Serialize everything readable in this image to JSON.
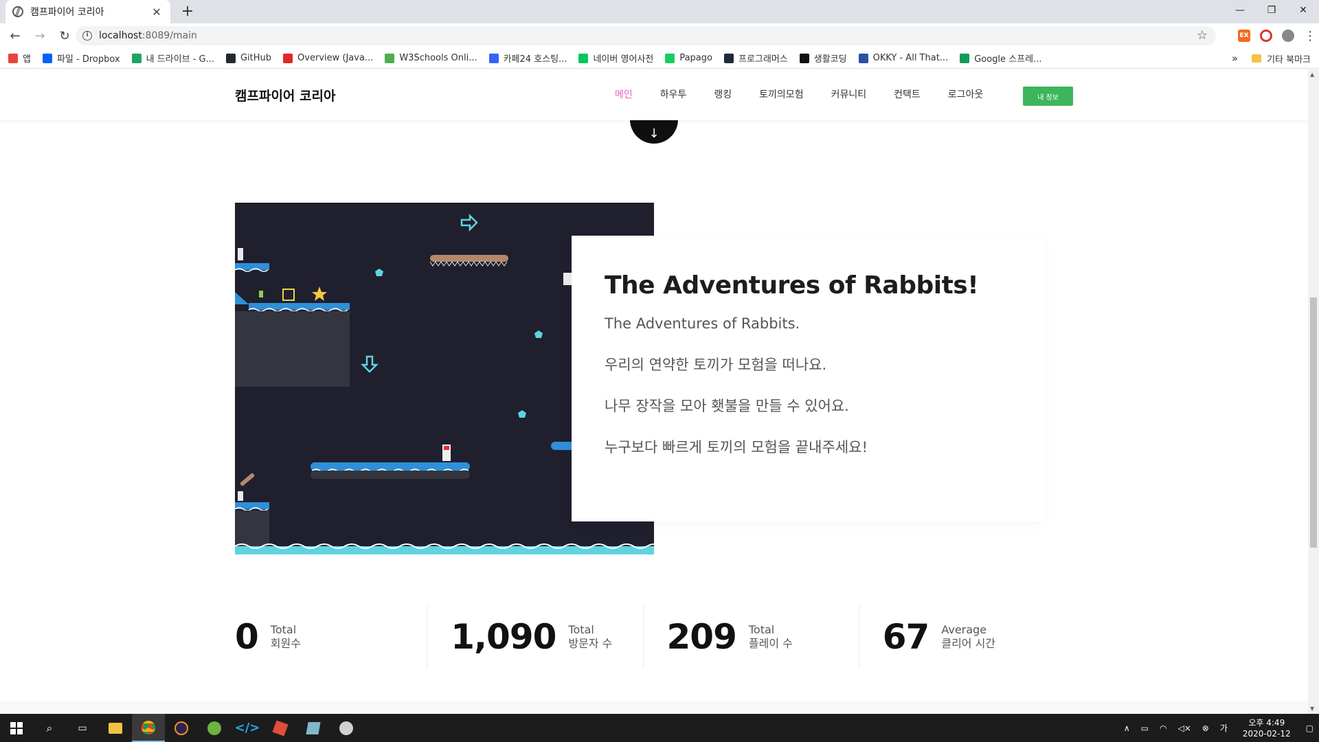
{
  "browser": {
    "tab_title": "캠프파이어 코리아",
    "url_host": "localhost",
    "url_rest": ":8089/main",
    "bookmarks": [
      {
        "label": "앱",
        "color": "#e8453c"
      },
      {
        "label": "파일 - Dropbox",
        "color": "#0061fe"
      },
      {
        "label": "내 드라이브 - G...",
        "color": "#1fa463"
      },
      {
        "label": "GitHub",
        "color": "#24292e"
      },
      {
        "label": "Overview (Java...",
        "color": "#e02828"
      },
      {
        "label": "W3Schools Onli...",
        "color": "#4caf50"
      },
      {
        "label": "카페24 호스팅...",
        "color": "#3463f6"
      },
      {
        "label": "네이버 영어사전",
        "color": "#03c75a"
      },
      {
        "label": "Papago",
        "color": "#19ce60"
      },
      {
        "label": "프로그래머스",
        "color": "#1e2a3a"
      },
      {
        "label": "생활코딩",
        "color": "#111111"
      },
      {
        "label": "OKKY - All That...",
        "color": "#2b4fa3"
      },
      {
        "label": "Google 스프레...",
        "color": "#0f9d58"
      }
    ],
    "bookmarks_other": "기타 북마크"
  },
  "header": {
    "brand": "캠프파이어 코리아",
    "nav": [
      "메인",
      "하우투",
      "랭킹",
      "토끼의모험",
      "커뮤니티",
      "컨택트",
      "로그아웃"
    ],
    "myinfo_button": "내 정보"
  },
  "feature": {
    "title": "The Adventures of Rabbits!",
    "lines": [
      "The Adventures of Rabbits.",
      "우리의 연약한 토끼가 모험을 떠나요.",
      "나무 장작을 모아 횃불을 만들 수 있어요.",
      "누구보다 빠르게 토끼의 모험을 끝내주세요!"
    ]
  },
  "stats": [
    {
      "value": "0",
      "label1": "Total",
      "label2": "회원수"
    },
    {
      "value": "1,090",
      "label1": "Total",
      "label2": "방문자 수"
    },
    {
      "value": "209",
      "label1": "Total",
      "label2": "플레이 수"
    },
    {
      "value": "67",
      "label1": "Average",
      "label2": "클리어 시간"
    }
  ],
  "taskbar": {
    "time": "오후 4:49",
    "date": "2020-02-12"
  },
  "colors": {
    "accent_nav": "#e85fc3",
    "button_green": "#3cb55b",
    "game_bg": "#1f1f2e",
    "water_blue": "#2f8fd8",
    "gem_cyan": "#5fd3e0"
  }
}
